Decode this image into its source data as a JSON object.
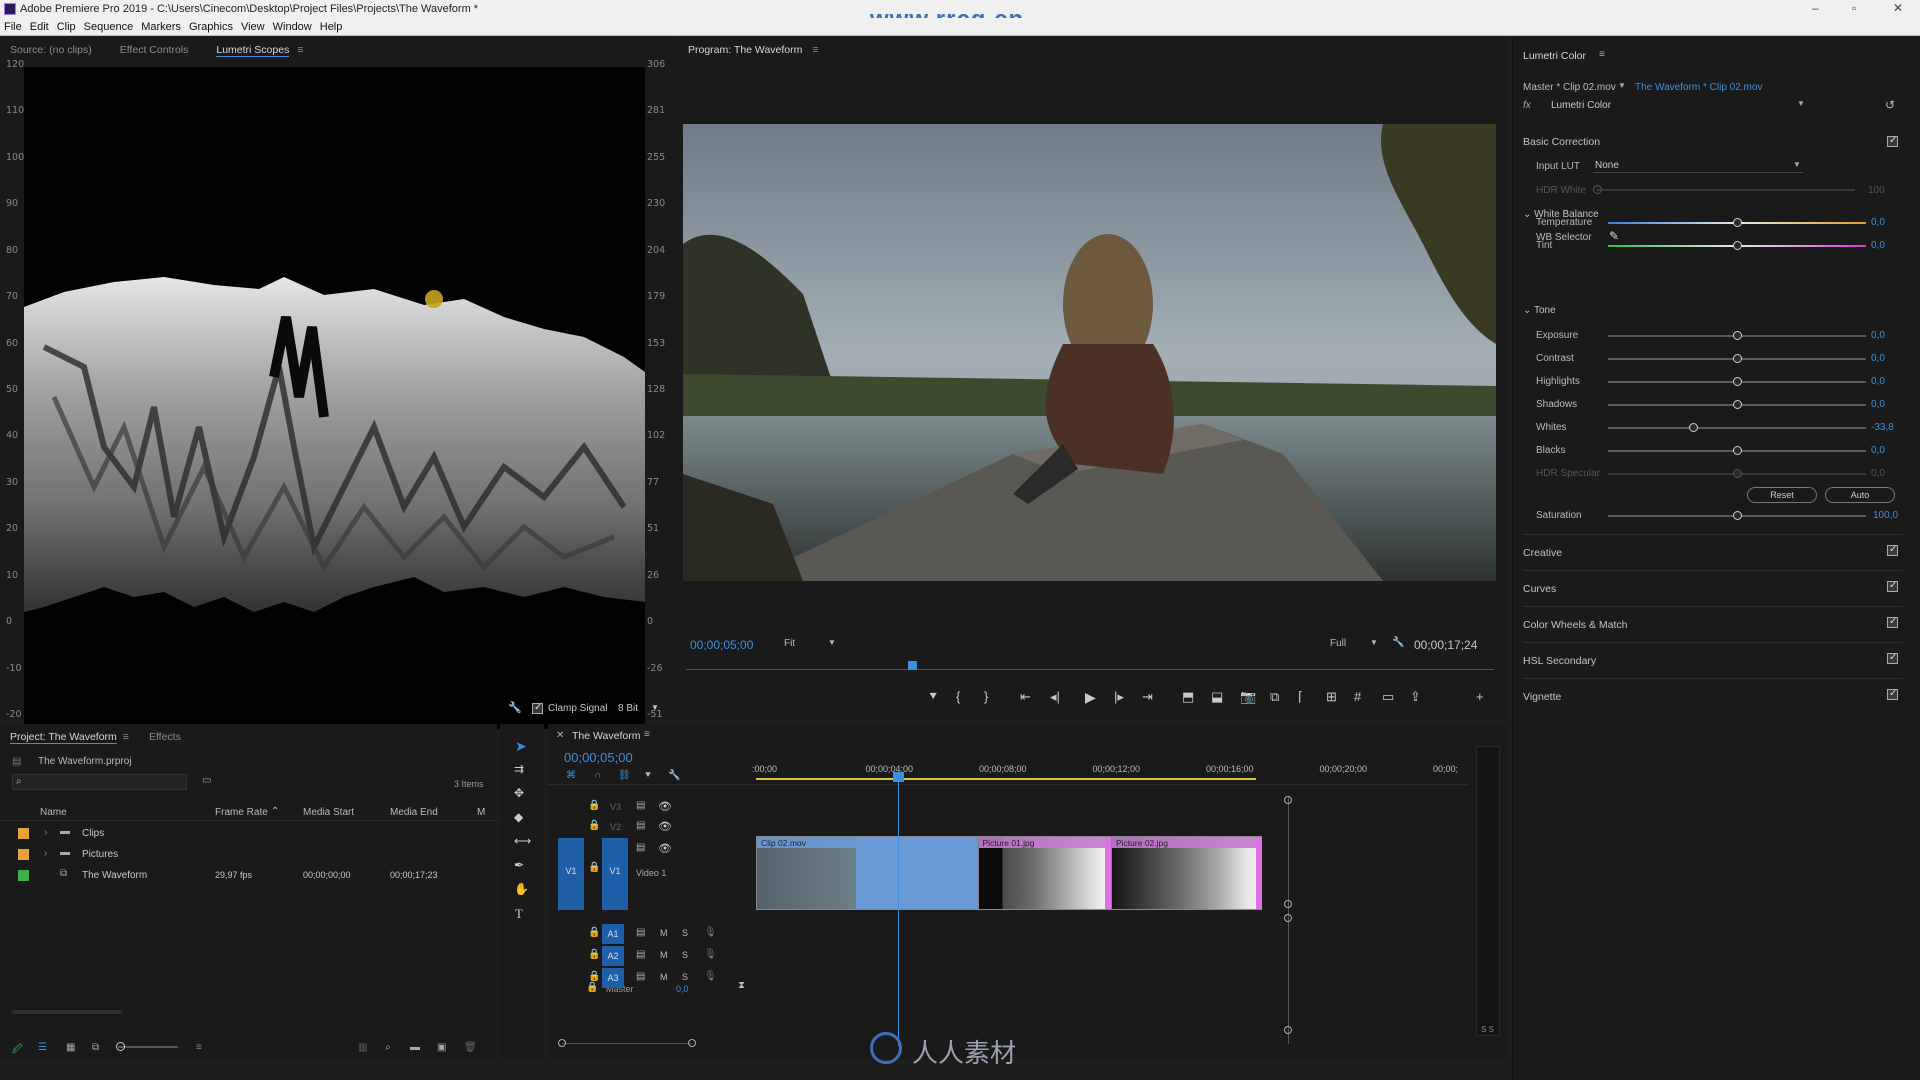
{
  "window": {
    "title": "Adobe Premiere Pro 2019 - C:\\Users\\Cinecom\\Desktop\\Project Files\\Projects\\The Waveform *",
    "watermark_top": "www.rrcg.cn",
    "watermark_bottom": "人人素材"
  },
  "menu": [
    "File",
    "Edit",
    "Clip",
    "Sequence",
    "Markers",
    "Graphics",
    "View",
    "Window",
    "Help"
  ],
  "source_panel": {
    "tabs": [
      "Source: (no clips)",
      "Effect Controls",
      "Lumetri Scopes"
    ],
    "active_tab": "Lumetri Scopes",
    "left_scale": [
      "120",
      "110",
      "100",
      "90",
      "80",
      "70",
      "60",
      "50",
      "40",
      "30",
      "20",
      "10",
      "0",
      "-10",
      "-20"
    ],
    "right_scale": [
      "306",
      "281",
      "255",
      "230",
      "204",
      "179",
      "153",
      "128",
      "102",
      "77",
      "51",
      "26",
      "0",
      "-26",
      "-51"
    ],
    "clamp_label": "Clamp Signal",
    "bit_depth": "8 Bit"
  },
  "program_monitor": {
    "title": "Program: The Waveform",
    "timecode_current": "00;00;05;00",
    "fit": "Fit",
    "resolution": "Full",
    "timecode_duration": "00;00;17;24",
    "playhead_fraction": 0.28
  },
  "lumetri": {
    "panel_title": "Lumetri Color",
    "master_clip": "Master * Clip 02.mov",
    "sequence_clip": "The Waveform * Clip 02.mov",
    "effect_name": "Lumetri Color",
    "basic_correction": "Basic Correction",
    "input_lut_label": "Input LUT",
    "input_lut_value": "None",
    "hdr_white_label": "HDR White",
    "hdr_white_value": "100",
    "white_balance": "White Balance",
    "wb_selector": "WB Selector",
    "tone": "Tone",
    "sliders_wb": [
      {
        "label": "Temperature",
        "value": "0,0",
        "pos": 0.5
      },
      {
        "label": "Tint",
        "value": "0,0",
        "pos": 0.5
      }
    ],
    "sliders_tone": [
      {
        "label": "Exposure",
        "value": "0,0",
        "pos": 0.5
      },
      {
        "label": "Contrast",
        "value": "0,0",
        "pos": 0.5
      },
      {
        "label": "Highlights",
        "value": "0,0",
        "pos": 0.5
      },
      {
        "label": "Shadows",
        "value": "0,0",
        "pos": 0.5
      },
      {
        "label": "Whites",
        "value": "-33,8",
        "pos": 0.33
      },
      {
        "label": "Blacks",
        "value": "0,0",
        "pos": 0.5
      },
      {
        "label": "HDR Specular",
        "value": "0,0",
        "pos": 0.5
      }
    ],
    "reset": "Reset",
    "auto": "Auto",
    "saturation_label": "Saturation",
    "saturation_value": "100,0",
    "saturation_pos": 0.5,
    "sections": [
      "Creative",
      "Curves",
      "Color Wheels & Match",
      "HSL Secondary",
      "Vignette"
    ]
  },
  "project_panel": {
    "tabs": [
      "Project: The Waveform",
      "Effects"
    ],
    "project_file": "The Waveform.prproj",
    "item_count": "3 Items",
    "columns": [
      "Name",
      "Frame Rate",
      "Media Start",
      "Media End",
      "M"
    ],
    "rows": [
      {
        "name": "Clips",
        "frame_rate": "",
        "media_start": "",
        "media_end": "",
        "color": "#e8a23a"
      },
      {
        "name": "Pictures",
        "frame_rate": "",
        "media_start": "",
        "media_end": "",
        "color": "#e8a23a"
      },
      {
        "name": "The Waveform",
        "frame_rate": "29,97 fps",
        "media_start": "00;00;00;00",
        "media_end": "00;00;17;23",
        "color": "#3fae49"
      }
    ]
  },
  "timeline": {
    "title": "The Waveform",
    "timecode": "00;00;05;00",
    "ruler": [
      ":00;00",
      "00;00;04;00",
      "00;00;08;00",
      "00;00;12;00",
      "00;00;16;00",
      "00;00;20;00",
      "00;00;"
    ],
    "video_tracks": [
      "V3",
      "V2",
      "V1"
    ],
    "v1_name": "Video 1",
    "audio_tracks": [
      "A1",
      "A2",
      "A3"
    ],
    "master_label": "Master",
    "master_value": "0,0",
    "clips": [
      {
        "name": "Clip 02.mov",
        "start_s": 0,
        "end_s": 7.8
      },
      {
        "name": "Picture 01.jpg",
        "start_s": 7.8,
        "end_s": 12.5
      },
      {
        "name": "Picture 02.jpg",
        "start_s": 12.5,
        "end_s": 17.8
      }
    ]
  }
}
